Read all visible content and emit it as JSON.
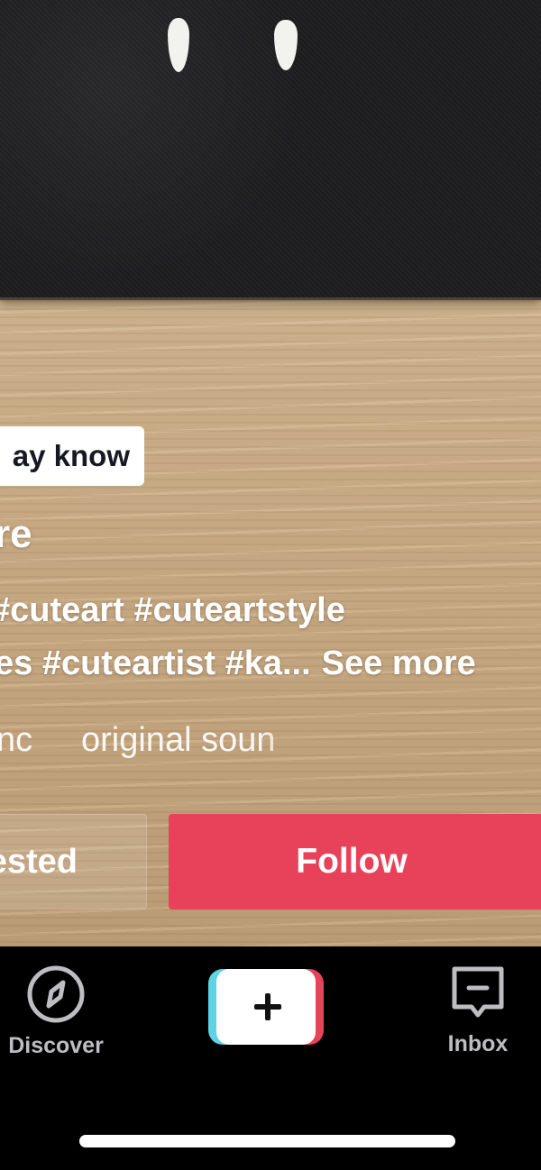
{
  "video": {
    "background_colors": {
      "felt": "#1e1e21",
      "wood": "#c9ad88"
    }
  },
  "overlay": {
    "suggestion_badge": "ay know",
    "username": "re",
    "caption": {
      "line1": "#cuteart #cuteartstyle",
      "line2": "es #cuteartist #ka...",
      "see_more": "See more"
    },
    "sound": {
      "left_text": "nc",
      "title": "original soun"
    }
  },
  "actions": {
    "not_interested_label": "ested",
    "follow_label": "Follow",
    "follow_color": "#e8425b"
  },
  "bottom_nav": {
    "items": [
      {
        "label": "Discover",
        "icon": "compass-icon"
      },
      {
        "label": "",
        "icon": "plus-icon"
      },
      {
        "label": "Inbox",
        "icon": "inbox-message-icon"
      }
    ]
  }
}
